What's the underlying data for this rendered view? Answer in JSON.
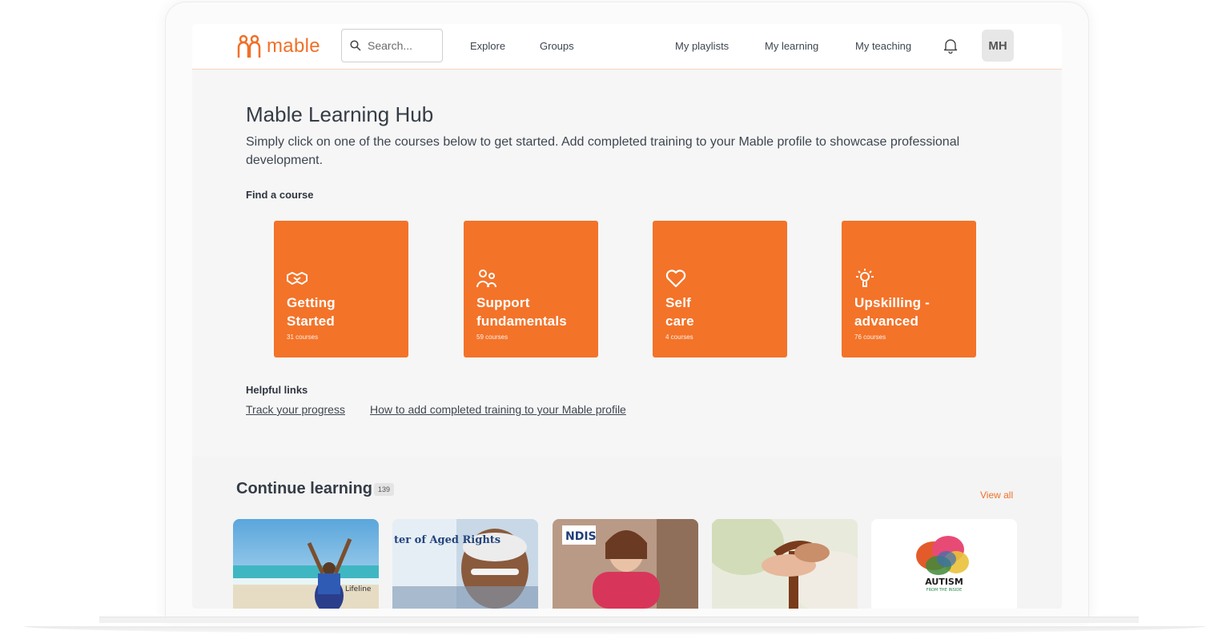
{
  "header": {
    "logo_text": "mable",
    "search_placeholder": "Search...",
    "nav": {
      "explore": "Explore",
      "groups": "Groups",
      "my_playlists": "My playlists",
      "my_learning": "My learning",
      "my_teaching": "My teaching"
    },
    "avatar_initials": "MH"
  },
  "hub": {
    "title": "Mable Learning Hub",
    "description": "Simply click on one of the courses below to get started. Add completed training to your Mable profile to showcase professional development.",
    "find_label": "Find a course",
    "tiles": [
      {
        "line1": "Getting",
        "line2": "Started",
        "count": "31 courses",
        "icon": "handshake-icon"
      },
      {
        "line1": "Support",
        "line2": "fundamentals",
        "count": "59 courses",
        "icon": "people-icon"
      },
      {
        "line1": "Self",
        "line2": "care",
        "count": "4 courses",
        "icon": "heart-icon"
      },
      {
        "line1": "Upskilling -",
        "line2": "advanced",
        "count": "76 courses",
        "icon": "lightbulb-icon"
      }
    ],
    "helpful_label": "Helpful links",
    "links": {
      "track": "Track your progress",
      "how_to": "How to add completed training to your Mable profile"
    }
  },
  "continue": {
    "title": "Continue learning",
    "count": "139",
    "view_all": "View all",
    "cards": [
      {
        "alt": "beach-woman-thumbnail",
        "text": "Lifeline"
      },
      {
        "alt": "aged-rights-thumbnail",
        "text": "ter of Aged Rights"
      },
      {
        "alt": "ndis-thumbnail",
        "text": "NDIS"
      },
      {
        "alt": "walking-stick-thumbnail",
        "text": ""
      },
      {
        "alt": "autism-thumbnail",
        "text": "AUTISM",
        "subtext": "FROM THE INSIDE"
      }
    ]
  },
  "colors": {
    "brand_orange": "#f37329",
    "text_dark": "#353c46"
  }
}
